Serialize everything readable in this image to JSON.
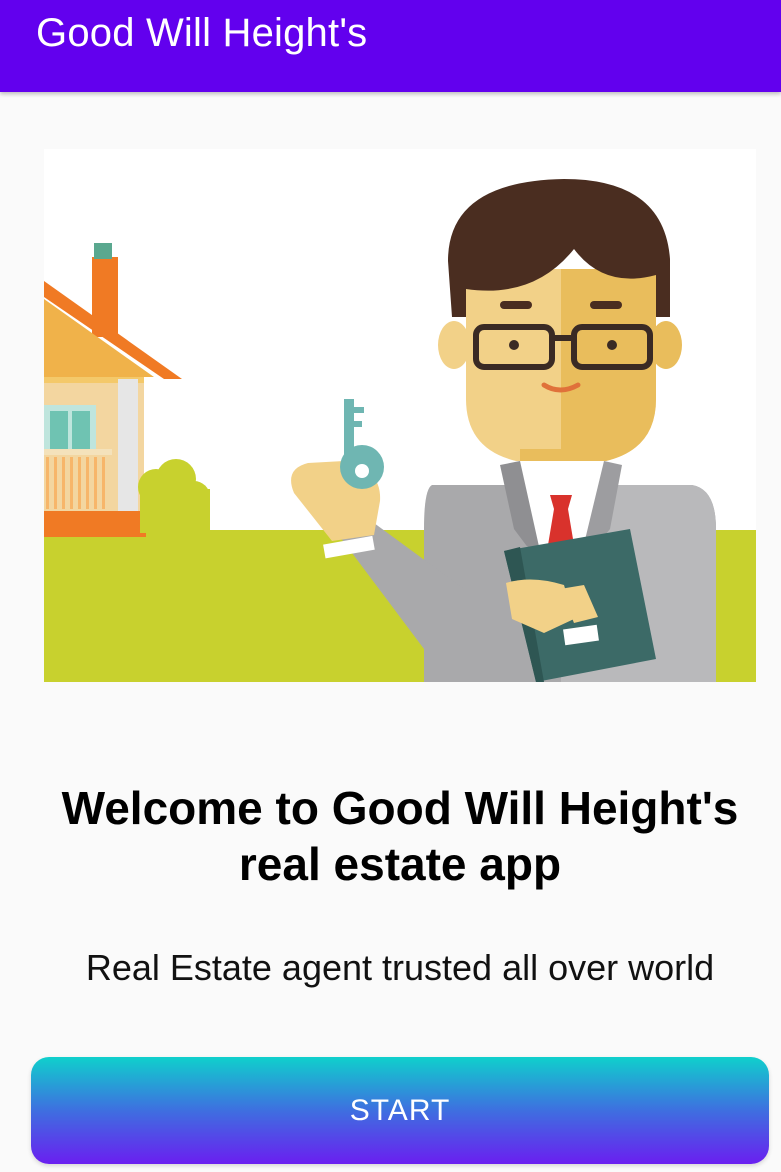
{
  "app_bar": {
    "title": "Good Will Height's",
    "color": "#6200ee"
  },
  "hero": {
    "icon": "real-estate-agent-illustration"
  },
  "main": {
    "welcome_heading_line1": "Welcome to Good Will Height's",
    "welcome_heading_line2": "real estate app",
    "tagline": "Real Estate agent trusted all over world"
  },
  "start_button": {
    "label": "START",
    "gradient": [
      "#0fd0cc",
      "#3e6fe0",
      "#6a1ff0"
    ]
  }
}
